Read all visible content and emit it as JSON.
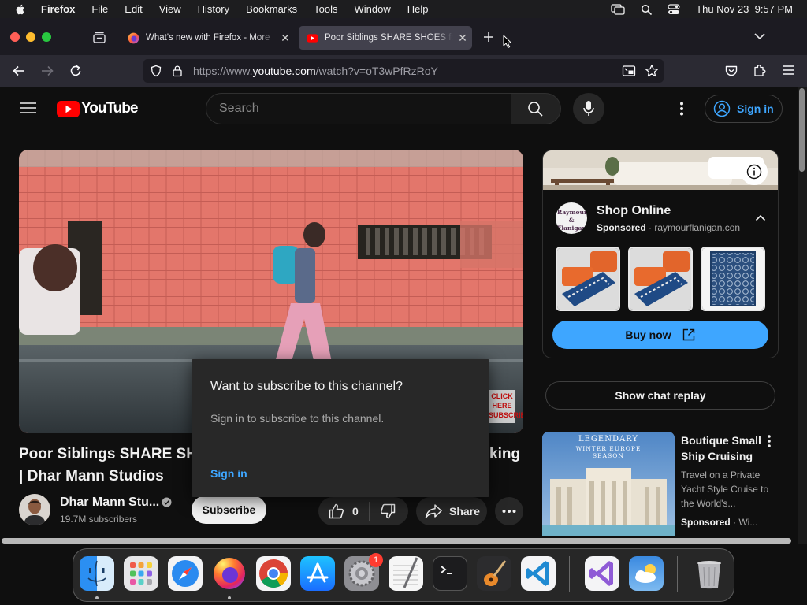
{
  "menubar": {
    "app": "Firefox",
    "items": [
      "File",
      "Edit",
      "View",
      "History",
      "Bookmarks",
      "Tools",
      "Window",
      "Help"
    ],
    "clock": "Thu Nov 23  9:57 PM"
  },
  "tabs": [
    {
      "title": "What's new with Firefox - More"
    },
    {
      "title": "Poor Siblings SHARE SHOES for"
    }
  ],
  "url": {
    "proto": "https://www.",
    "host": "youtube.com",
    "path": "/watch?v=oT3wPfRzRoY"
  },
  "youtube": {
    "logo_text": "YouTube",
    "search_placeholder": "Search",
    "signin_label": "Sign in",
    "video_overlay_text": "CLICK HERE SUBSCRIBE",
    "video_title_line1_start": "Poor Siblings SHARE SHO",
    "video_title_line1_end": "king",
    "video_title_line2": "| Dhar Mann Studios",
    "channel_name": "Dhar Mann Stu...",
    "subscribers": "19.7M subscribers",
    "subscribe_label": "Subscribe",
    "like_count": "0",
    "share_label": "Share",
    "chat_replay_label": "Show chat replay"
  },
  "popup": {
    "title": "Want to subscribe to this channel?",
    "body": "Sign in to subscribe to this channel.",
    "link": "Sign in"
  },
  "ad": {
    "logo_text": "Raymour & Flanigan",
    "title": "Shop Online",
    "sponsored": "Sponsored",
    "domain": "raymourflanigan.con",
    "cta": "Buy now"
  },
  "recommended": {
    "thumb_line1": "LEGENDARY",
    "thumb_line2": "WINTER EUROPE",
    "thumb_line3": "SEASON",
    "title": "Boutique Small Ship Cruising",
    "description": "Travel on a Private Yacht Style Cruise to the World's...",
    "sponsored": "Sponsored",
    "source": "Wi..."
  },
  "dock": {
    "settings_badge": "1"
  },
  "colors": {
    "yt_red": "#ff0000",
    "link_blue": "#3ea6ff",
    "buy_blue": "#3ea6ff"
  }
}
